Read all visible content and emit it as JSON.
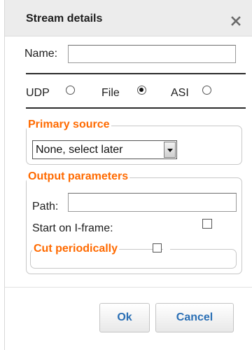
{
  "dialog": {
    "title": "Stream details",
    "close_icon": "close-x-icon"
  },
  "name_field": {
    "label": "Name:",
    "value": ""
  },
  "source_type": {
    "options": [
      {
        "label": "UDP",
        "checked": false
      },
      {
        "label": "File",
        "checked": true
      },
      {
        "label": "ASI",
        "checked": false
      }
    ]
  },
  "primary_source": {
    "legend": "Primary source",
    "selected": "None, select later"
  },
  "output_parameters": {
    "legend": "Output parameters",
    "path_label": "Path:",
    "path_value": "",
    "iframe_label": "Start on I-frame:",
    "iframe_checked": false,
    "cut_legend": "Cut periodically",
    "cut_checked": false
  },
  "buttons": {
    "ok": "Ok",
    "cancel": "Cancel"
  },
  "colors": {
    "accent": "#ff6a00",
    "button_text": "#2a6fb5",
    "titlebar": "#ececec"
  }
}
